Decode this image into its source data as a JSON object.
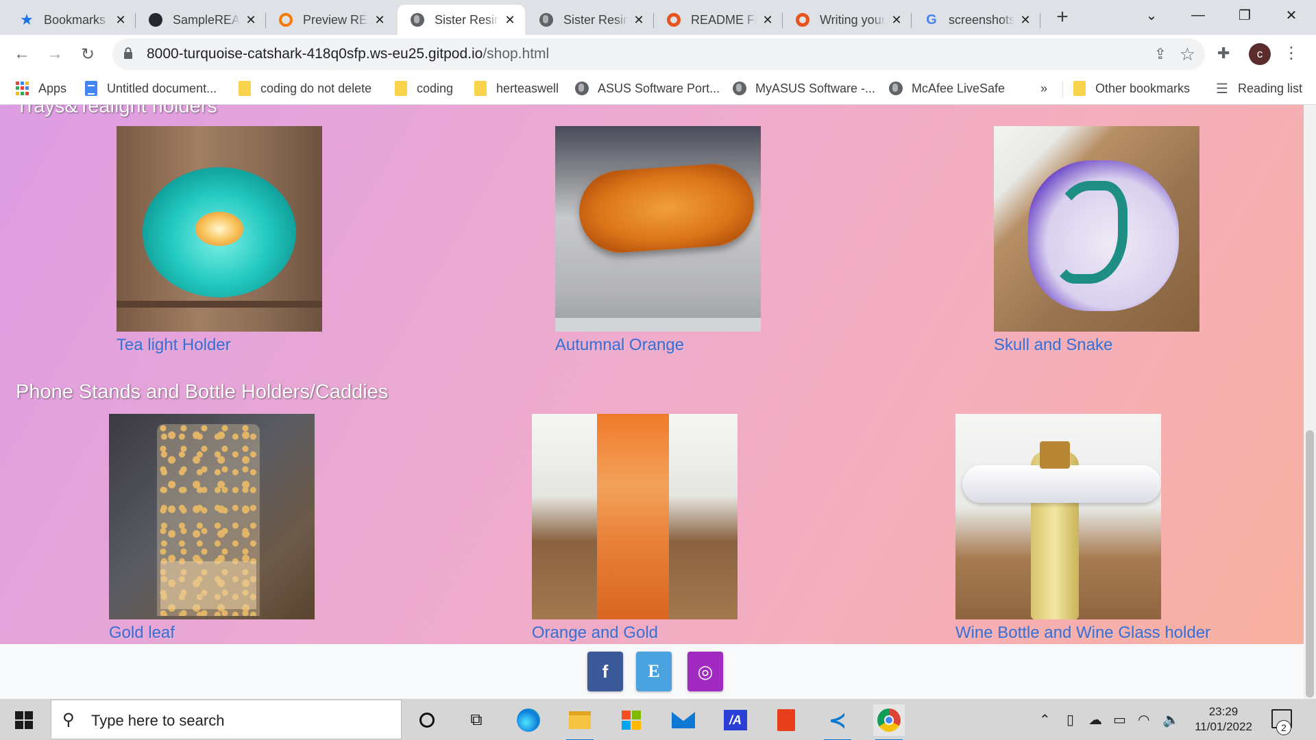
{
  "browser": {
    "tabs": [
      {
        "title": "Bookmarks",
        "icon": "bookmark-star-icon",
        "active": false
      },
      {
        "title": "SampleREADME",
        "icon": "github-icon",
        "active": false
      },
      {
        "title": "Preview README",
        "icon": "preview-icon",
        "active": false
      },
      {
        "title": "Sister Resin",
        "icon": "globe-icon",
        "active": true
      },
      {
        "title": "Sister Resin",
        "icon": "globe-icon",
        "active": false
      },
      {
        "title": "README File",
        "icon": "circle-logo-icon",
        "active": false
      },
      {
        "title": "Writing your",
        "icon": "circle-logo-icon",
        "active": false
      },
      {
        "title": "screenshots",
        "icon": "google-icon",
        "active": false
      }
    ],
    "url_host": "8000-turquoise-catshark-418q0sfp.ws-eu25.gitpod.io",
    "url_path": "/shop.html",
    "profile_initial": "c"
  },
  "bookmarks": {
    "items": [
      {
        "label": "Apps",
        "icon": "apps-grid-icon"
      },
      {
        "label": "Untitled document...",
        "icon": "google-docs-icon"
      },
      {
        "label": "coding do not delete",
        "icon": "folder-icon"
      },
      {
        "label": "coding",
        "icon": "folder-icon"
      },
      {
        "label": "herteaswell",
        "icon": "folder-icon"
      },
      {
        "label": "ASUS Software Port...",
        "icon": "globe-icon"
      },
      {
        "label": "MyASUS Software -...",
        "icon": "globe-icon"
      },
      {
        "label": "McAfee LiveSafe",
        "icon": "globe-icon"
      }
    ],
    "overflow": "»",
    "other": "Other bookmarks",
    "reading_list": "Reading list"
  },
  "shop": {
    "sections": [
      {
        "heading": "Trays&Tealight holders",
        "products": [
          {
            "name": "Tea light Holder"
          },
          {
            "name": "Autumnal Orange"
          },
          {
            "name": "Skull and Snake"
          }
        ]
      },
      {
        "heading": "Phone Stands and Bottle Holders/Caddies",
        "products": [
          {
            "name": "Gold leaf"
          },
          {
            "name": "Orange and Gold"
          },
          {
            "name": "Wine Bottle and Wine Glass holder"
          }
        ]
      }
    ]
  },
  "footer": {
    "social": [
      {
        "name": "facebook",
        "glyph": "f",
        "color": "#3b5998"
      },
      {
        "name": "etsy",
        "glyph": "E",
        "color": "#4aa3df"
      },
      {
        "name": "instagram",
        "glyph": "◎",
        "color": "#a12ac0"
      }
    ]
  },
  "taskbar": {
    "search_placeholder": "Type here to search",
    "time": "23:29",
    "date": "11/01/2022",
    "notification_count": "2"
  }
}
